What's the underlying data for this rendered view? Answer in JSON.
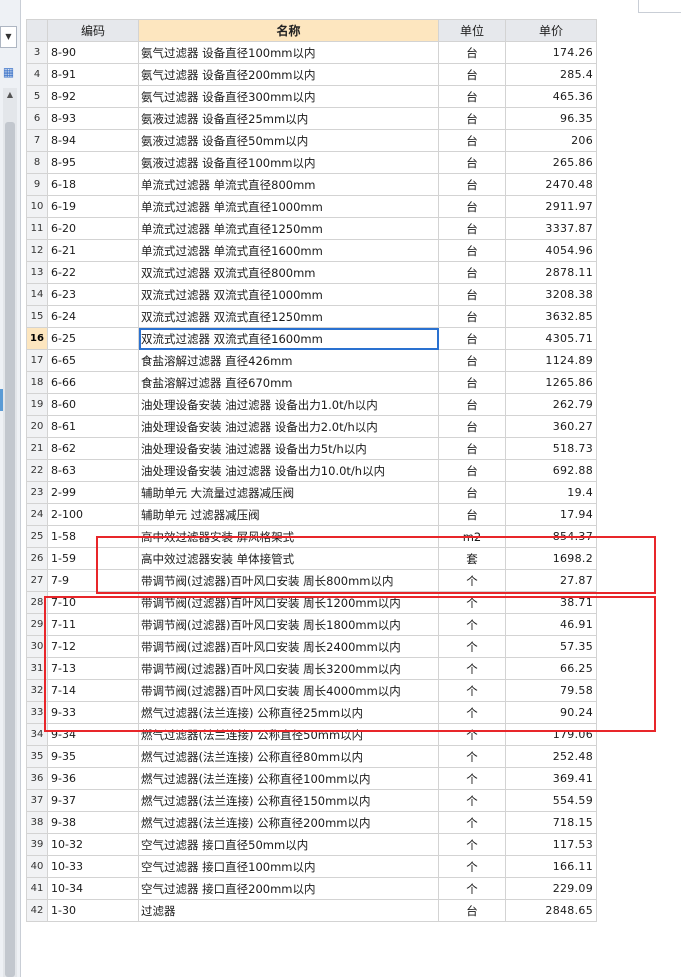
{
  "sidebar": {
    "dropdown_icon": "chevron-down-icon",
    "tool_icon": "grid-tool-icon",
    "scroll_up_icon": "triangle-up-icon"
  },
  "table": {
    "headers": {
      "code": "编码",
      "name": "名称",
      "unit": "单位",
      "price": "单价"
    },
    "active_row": "16",
    "rows": [
      {
        "rn": "3",
        "code": "8-90",
        "name": "氨气过滤器 设备直径100mm以内",
        "unit": "台",
        "price": "174.26"
      },
      {
        "rn": "4",
        "code": "8-91",
        "name": "氨气过滤器 设备直径200mm以内",
        "unit": "台",
        "price": "285.4"
      },
      {
        "rn": "5",
        "code": "8-92",
        "name": "氨气过滤器 设备直径300mm以内",
        "unit": "台",
        "price": "465.36"
      },
      {
        "rn": "6",
        "code": "8-93",
        "name": "氨液过滤器 设备直径25mm以内",
        "unit": "台",
        "price": "96.35"
      },
      {
        "rn": "7",
        "code": "8-94",
        "name": "氨液过滤器 设备直径50mm以内",
        "unit": "台",
        "price": "206"
      },
      {
        "rn": "8",
        "code": "8-95",
        "name": "氨液过滤器 设备直径100mm以内",
        "unit": "台",
        "price": "265.86"
      },
      {
        "rn": "9",
        "code": "6-18",
        "name": "单流式过滤器 单流式直径800mm",
        "unit": "台",
        "price": "2470.48"
      },
      {
        "rn": "10",
        "code": "6-19",
        "name": "单流式过滤器 单流式直径1000mm",
        "unit": "台",
        "price": "2911.97"
      },
      {
        "rn": "11",
        "code": "6-20",
        "name": "单流式过滤器 单流式直径1250mm",
        "unit": "台",
        "price": "3337.87"
      },
      {
        "rn": "12",
        "code": "6-21",
        "name": "单流式过滤器 单流式直径1600mm",
        "unit": "台",
        "price": "4054.96"
      },
      {
        "rn": "13",
        "code": "6-22",
        "name": "双流式过滤器 双流式直径800mm",
        "unit": "台",
        "price": "2878.11"
      },
      {
        "rn": "14",
        "code": "6-23",
        "name": "双流式过滤器 双流式直径1000mm",
        "unit": "台",
        "price": "3208.38"
      },
      {
        "rn": "15",
        "code": "6-24",
        "name": "双流式过滤器 双流式直径1250mm",
        "unit": "台",
        "price": "3632.85"
      },
      {
        "rn": "16",
        "code": "6-25",
        "name": "双流式过滤器 双流式直径1600mm",
        "unit": "台",
        "price": "4305.71"
      },
      {
        "rn": "17",
        "code": "6-65",
        "name": "食盐溶解过滤器 直径426mm",
        "unit": "台",
        "price": "1124.89"
      },
      {
        "rn": "18",
        "code": "6-66",
        "name": "食盐溶解过滤器 直径670mm",
        "unit": "台",
        "price": "1265.86"
      },
      {
        "rn": "19",
        "code": "8-60",
        "name": "油处理设备安装 油过滤器 设备出力1.0t/h以内",
        "unit": "台",
        "price": "262.79"
      },
      {
        "rn": "20",
        "code": "8-61",
        "name": "油处理设备安装 油过滤器 设备出力2.0t/h以内",
        "unit": "台",
        "price": "360.27"
      },
      {
        "rn": "21",
        "code": "8-62",
        "name": "油处理设备安装 油过滤器 设备出力5t/h以内",
        "unit": "台",
        "price": "518.73"
      },
      {
        "rn": "22",
        "code": "8-63",
        "name": "油处理设备安装 油过滤器 设备出力10.0t/h以内",
        "unit": "台",
        "price": "692.88"
      },
      {
        "rn": "23",
        "code": "2-99",
        "name": "辅助单元 大流量过滤器减压阀",
        "unit": "台",
        "price": "19.4"
      },
      {
        "rn": "24",
        "code": "2-100",
        "name": "辅助单元 过滤器减压阀",
        "unit": "台",
        "price": "17.94"
      },
      {
        "rn": "25",
        "code": "1-58",
        "name": "高中效过滤器安装 屏风格架式",
        "unit": "m2",
        "price": "854.37"
      },
      {
        "rn": "26",
        "code": "1-59",
        "name": "高中效过滤器安装 单体接管式",
        "unit": "套",
        "price": "1698.2"
      },
      {
        "rn": "27",
        "code": "7-9",
        "name": "带调节阀(过滤器)百叶风口安装 周长800mm以内",
        "unit": "个",
        "price": "27.87"
      },
      {
        "rn": "28",
        "code": "7-10",
        "name": "带调节阀(过滤器)百叶风口安装 周长1200mm以内",
        "unit": "个",
        "price": "38.71"
      },
      {
        "rn": "29",
        "code": "7-11",
        "name": "带调节阀(过滤器)百叶风口安装 周长1800mm以内",
        "unit": "个",
        "price": "46.91"
      },
      {
        "rn": "30",
        "code": "7-12",
        "name": "带调节阀(过滤器)百叶风口安装 周长2400mm以内",
        "unit": "个",
        "price": "57.35"
      },
      {
        "rn": "31",
        "code": "7-13",
        "name": "带调节阀(过滤器)百叶风口安装 周长3200mm以内",
        "unit": "个",
        "price": "66.25"
      },
      {
        "rn": "32",
        "code": "7-14",
        "name": "带调节阀(过滤器)百叶风口安装 周长4000mm以内",
        "unit": "个",
        "price": "79.58"
      },
      {
        "rn": "33",
        "code": "9-33",
        "name": "燃气过滤器(法兰连接) 公称直径25mm以内",
        "unit": "个",
        "price": "90.24"
      },
      {
        "rn": "34",
        "code": "9-34",
        "name": "燃气过滤器(法兰连接) 公称直径50mm以内",
        "unit": "个",
        "price": "179.06"
      },
      {
        "rn": "35",
        "code": "9-35",
        "name": "燃气过滤器(法兰连接) 公称直径80mm以内",
        "unit": "个",
        "price": "252.48"
      },
      {
        "rn": "36",
        "code": "9-36",
        "name": "燃气过滤器(法兰连接) 公称直径100mm以内",
        "unit": "个",
        "price": "369.41"
      },
      {
        "rn": "37",
        "code": "9-37",
        "name": "燃气过滤器(法兰连接) 公称直径150mm以内",
        "unit": "个",
        "price": "554.59"
      },
      {
        "rn": "38",
        "code": "9-38",
        "name": "燃气过滤器(法兰连接) 公称直径200mm以内",
        "unit": "个",
        "price": "718.15"
      },
      {
        "rn": "39",
        "code": "10-32",
        "name": "空气过滤器 接口直径50mm以内",
        "unit": "个",
        "price": "117.53"
      },
      {
        "rn": "40",
        "code": "10-33",
        "name": "空气过滤器 接口直径100mm以内",
        "unit": "个",
        "price": "166.11"
      },
      {
        "rn": "41",
        "code": "10-34",
        "name": "空气过滤器 接口直径200mm以内",
        "unit": "个",
        "price": "229.09"
      },
      {
        "rn": "42",
        "code": "1-30",
        "name": "过滤器",
        "unit": "台",
        "price": "2848.65"
      }
    ]
  },
  "colors": {
    "highlight_box": "#e8262a",
    "header_bg": "#e6e8ec",
    "active_header_bg": "#fde6bf",
    "selection_border": "#2a71d0"
  }
}
